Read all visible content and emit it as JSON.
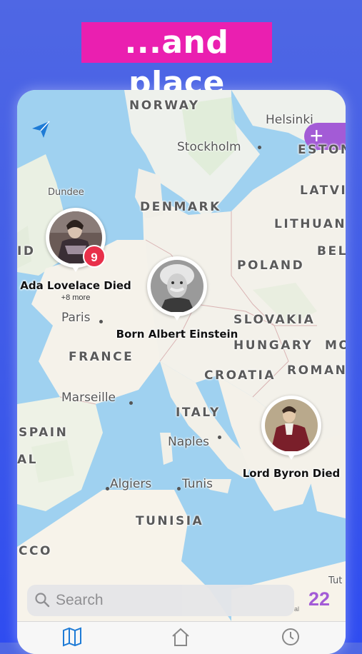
{
  "banner": {
    "text": "...and place"
  },
  "map": {
    "countries": [
      {
        "key": "norway",
        "label": "NORWAY"
      },
      {
        "key": "estonia",
        "label": "ESTON"
      },
      {
        "key": "latvia",
        "label": "LATVI"
      },
      {
        "key": "denmark",
        "label": "DENMARK"
      },
      {
        "key": "lithuania",
        "label": "LITHUAN"
      },
      {
        "key": "belarus",
        "label": "BEL"
      },
      {
        "key": "ireland",
        "label": "ID"
      },
      {
        "key": "poland",
        "label": "POLAND"
      },
      {
        "key": "slovakia",
        "label": "SLOVAKIA"
      },
      {
        "key": "hungary",
        "label": "HUNGARY"
      },
      {
        "key": "moldova",
        "label": "MO"
      },
      {
        "key": "france",
        "label": "FRANCE"
      },
      {
        "key": "croatia",
        "label": "CROATIA"
      },
      {
        "key": "romania",
        "label": "ROMAN"
      },
      {
        "key": "italy",
        "label": "ITALY"
      },
      {
        "key": "spain",
        "label": "SPAIN"
      },
      {
        "key": "portugal",
        "label": "AL"
      },
      {
        "key": "tunisia",
        "label": "TUNISIA"
      },
      {
        "key": "morocco",
        "label": "CCO"
      }
    ],
    "cities": [
      {
        "key": "helsinki",
        "label": "Helsinki"
      },
      {
        "key": "stockholm",
        "label": "Stockholm"
      },
      {
        "key": "dundee",
        "label": "Dundee"
      },
      {
        "key": "paris",
        "label": "Paris"
      },
      {
        "key": "marseille",
        "label": "Marseille"
      },
      {
        "key": "naples",
        "label": "Naples"
      },
      {
        "key": "algiers",
        "label": "Algiers"
      },
      {
        "key": "tunis",
        "label": "Tunis"
      },
      {
        "key": "tut",
        "label": "Tut"
      }
    ]
  },
  "pins": [
    {
      "key": "ada",
      "caption": "Ada Lovelace Died",
      "more": "+8 more",
      "badge": "9"
    },
    {
      "key": "einstein",
      "caption": "Born Albert Einstein"
    },
    {
      "key": "byron",
      "caption": "Lord Byron Died"
    }
  ],
  "toolbar": {
    "add_label": "+",
    "plane_icon": "paper-plane-icon"
  },
  "search": {
    "placeholder": "Search"
  },
  "count": "22",
  "legal": "al",
  "tabs": [
    {
      "key": "map",
      "icon": "map-icon"
    },
    {
      "key": "home",
      "icon": "home-icon"
    },
    {
      "key": "history",
      "icon": "clock-icon"
    }
  ],
  "colors": {
    "accent": "#a35bd6",
    "banner": "#ea1fb0",
    "badge": "#e8304a",
    "background": "#3f5be8"
  }
}
